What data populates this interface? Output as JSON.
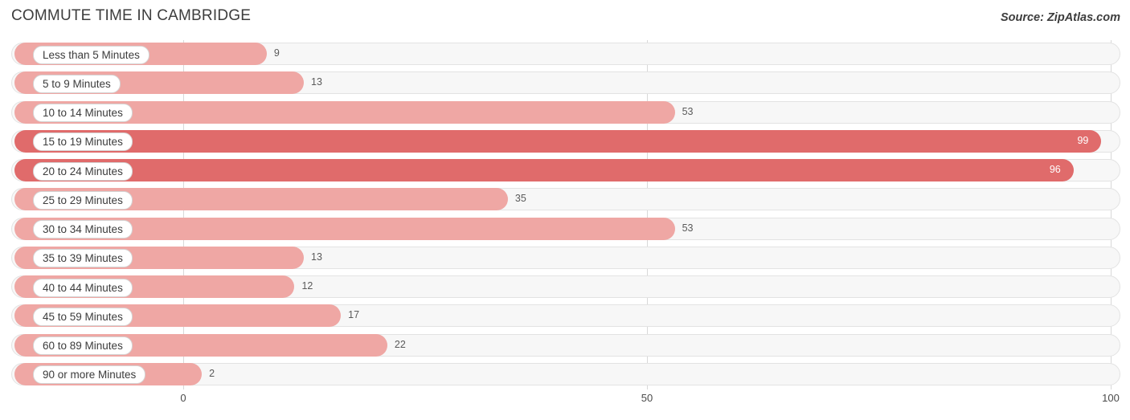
{
  "header": {
    "title": "COMMUTE TIME IN CAMBRIDGE",
    "source": "Source: ZipAtlas.com"
  },
  "colors": {
    "bar_light": "#efa7a4",
    "bar_dark": "#e06b6b",
    "track": "#f7f7f7",
    "grid": "#d8d8d8",
    "text": "#3d3d3d"
  },
  "chart_data": {
    "type": "bar",
    "orientation": "horizontal",
    "title": "COMMUTE TIME IN CAMBRIDGE",
    "xlabel": "",
    "ylabel": "",
    "xlim": [
      0,
      100
    ],
    "xticks": [
      0,
      50,
      100
    ],
    "xtick_labels": [
      "0",
      "50",
      "100"
    ],
    "grid": true,
    "legend": "none",
    "categories": [
      "Less than 5 Minutes",
      "5 to 9 Minutes",
      "10 to 14 Minutes",
      "15 to 19 Minutes",
      "20 to 24 Minutes",
      "25 to 29 Minutes",
      "30 to 34 Minutes",
      "35 to 39 Minutes",
      "40 to 44 Minutes",
      "45 to 59 Minutes",
      "60 to 89 Minutes",
      "90 or more Minutes"
    ],
    "values": [
      9,
      13,
      53,
      99,
      96,
      35,
      53,
      13,
      12,
      17,
      22,
      2
    ],
    "value_labels": [
      "9",
      "13",
      "53",
      "99",
      "96",
      "35",
      "53",
      "13",
      "12",
      "17",
      "22",
      "2"
    ]
  }
}
